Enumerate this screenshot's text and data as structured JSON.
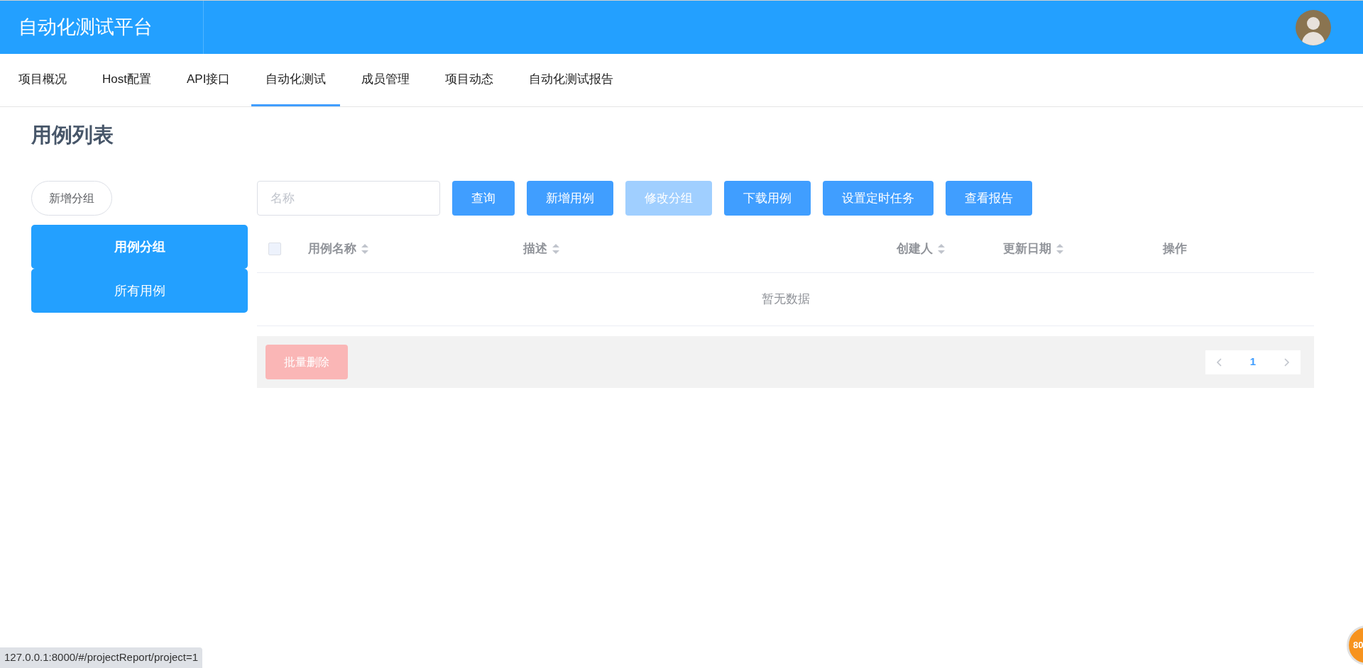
{
  "header": {
    "title": "自动化测试平台"
  },
  "nav_tabs": [
    {
      "label": "项目概况",
      "selected": false
    },
    {
      "label": "Host配置",
      "selected": false
    },
    {
      "label": "API接口",
      "selected": false
    },
    {
      "label": "自动化测试",
      "selected": true
    },
    {
      "label": "成员管理",
      "selected": false
    },
    {
      "label": "项目动态",
      "selected": false
    },
    {
      "label": "自动化测试报告",
      "selected": false
    }
  ],
  "page_title": "用例列表",
  "sidebar": {
    "add_button": "新增分组",
    "items": [
      {
        "label": "用例分组",
        "selected": true
      },
      {
        "label": "所有用例",
        "selected": false
      }
    ]
  },
  "search": {
    "placeholder": "名称"
  },
  "toolbar_buttons": [
    {
      "label": "查询",
      "disabled": false
    },
    {
      "label": "新增用例",
      "disabled": false
    },
    {
      "label": "修改分组",
      "disabled": true
    },
    {
      "label": "下载用例",
      "disabled": false
    },
    {
      "label": "设置定时任务",
      "disabled": false
    },
    {
      "label": "查看报告",
      "disabled": false
    }
  ],
  "table": {
    "select_all_checked": false,
    "columns": [
      {
        "label": "用例名称",
        "sortable": true
      },
      {
        "label": "描述",
        "sortable": true
      },
      {
        "label": "创建人",
        "sortable": true
      },
      {
        "label": "更新日期",
        "sortable": true
      },
      {
        "label": "操作",
        "sortable": false
      }
    ],
    "empty_text": "暂无数据"
  },
  "footer": {
    "batch_delete": {
      "label": "批量删除",
      "disabled": true
    },
    "pagination": {
      "pages": [
        {
          "label": "1",
          "selected": true
        }
      ]
    }
  },
  "status_bar": {
    "url": "127.0.0.1:8000/#/projectReport/project=1"
  },
  "floating_badge": {
    "label": "80"
  }
}
